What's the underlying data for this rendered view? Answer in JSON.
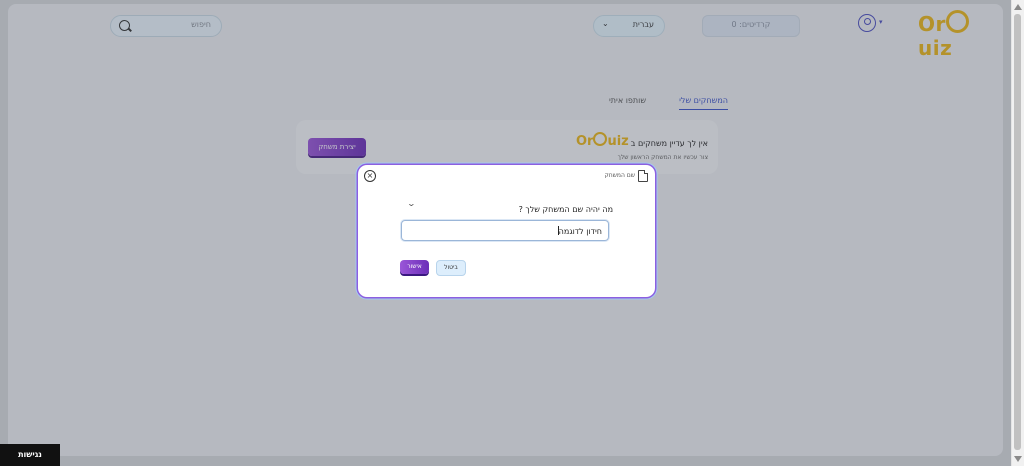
{
  "header": {
    "search_label": "חיפוש",
    "language": "עברית",
    "credits": "קרדיטים: 0",
    "logo_text_left": "Or",
    "logo_text_right": "uiz"
  },
  "tabs": {
    "my_games": "המשחקים שלי",
    "shared_with_me": "שותפו איתי"
  },
  "empty_state": {
    "title": "אין לך עדיין משחקים ב -",
    "subtitle": "צור עכשיו את המשחק הראשון שלך",
    "create_button": "יצירת משחק"
  },
  "modal": {
    "title": "שם המשחק",
    "question": "מה יהיה שם המשחק שלך ?",
    "input_value": "חידון לדוגמה",
    "cancel_button": "ביטול",
    "ok_button": "אישור"
  },
  "accessibility_button": "נגישות",
  "colors": {
    "brand_yellow": "#e8b51a",
    "accent_blue": "#3c52c8",
    "button_purple": "#7a38c8"
  }
}
